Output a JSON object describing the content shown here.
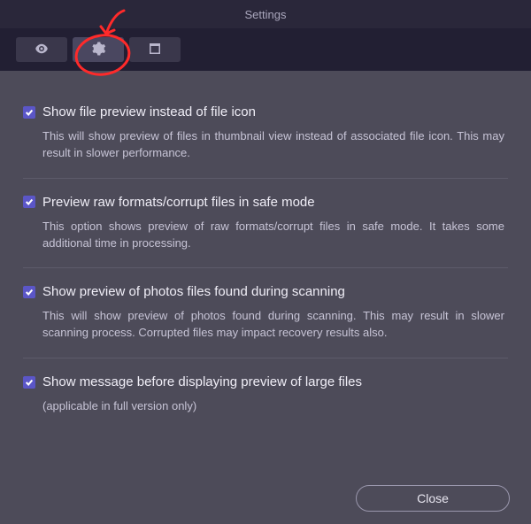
{
  "window": {
    "title": "Settings"
  },
  "tabs": {
    "view": {
      "icon": "eye-icon"
    },
    "gear": {
      "icon": "gear-icon",
      "active": true
    },
    "window": {
      "icon": "window-icon"
    }
  },
  "options": [
    {
      "label": "Show file preview instead of file icon",
      "checked": true,
      "description": "This will show preview of files in thumbnail view instead of associated file icon. This may result in slower performance."
    },
    {
      "label": "Preview raw formats/corrupt files in safe mode",
      "checked": true,
      "description": "This option shows preview of raw formats/corrupt files in safe mode. It takes some additional time in processing."
    },
    {
      "label": "Show preview of photos files found during scanning",
      "checked": true,
      "description": "This will show preview of photos found during scanning. This may result in slower scanning process. Corrupted files may impact recovery results also."
    },
    {
      "label": "Show message before displaying preview of large files",
      "checked": true,
      "description": "(applicable in full version only)"
    }
  ],
  "footer": {
    "close_label": "Close"
  }
}
